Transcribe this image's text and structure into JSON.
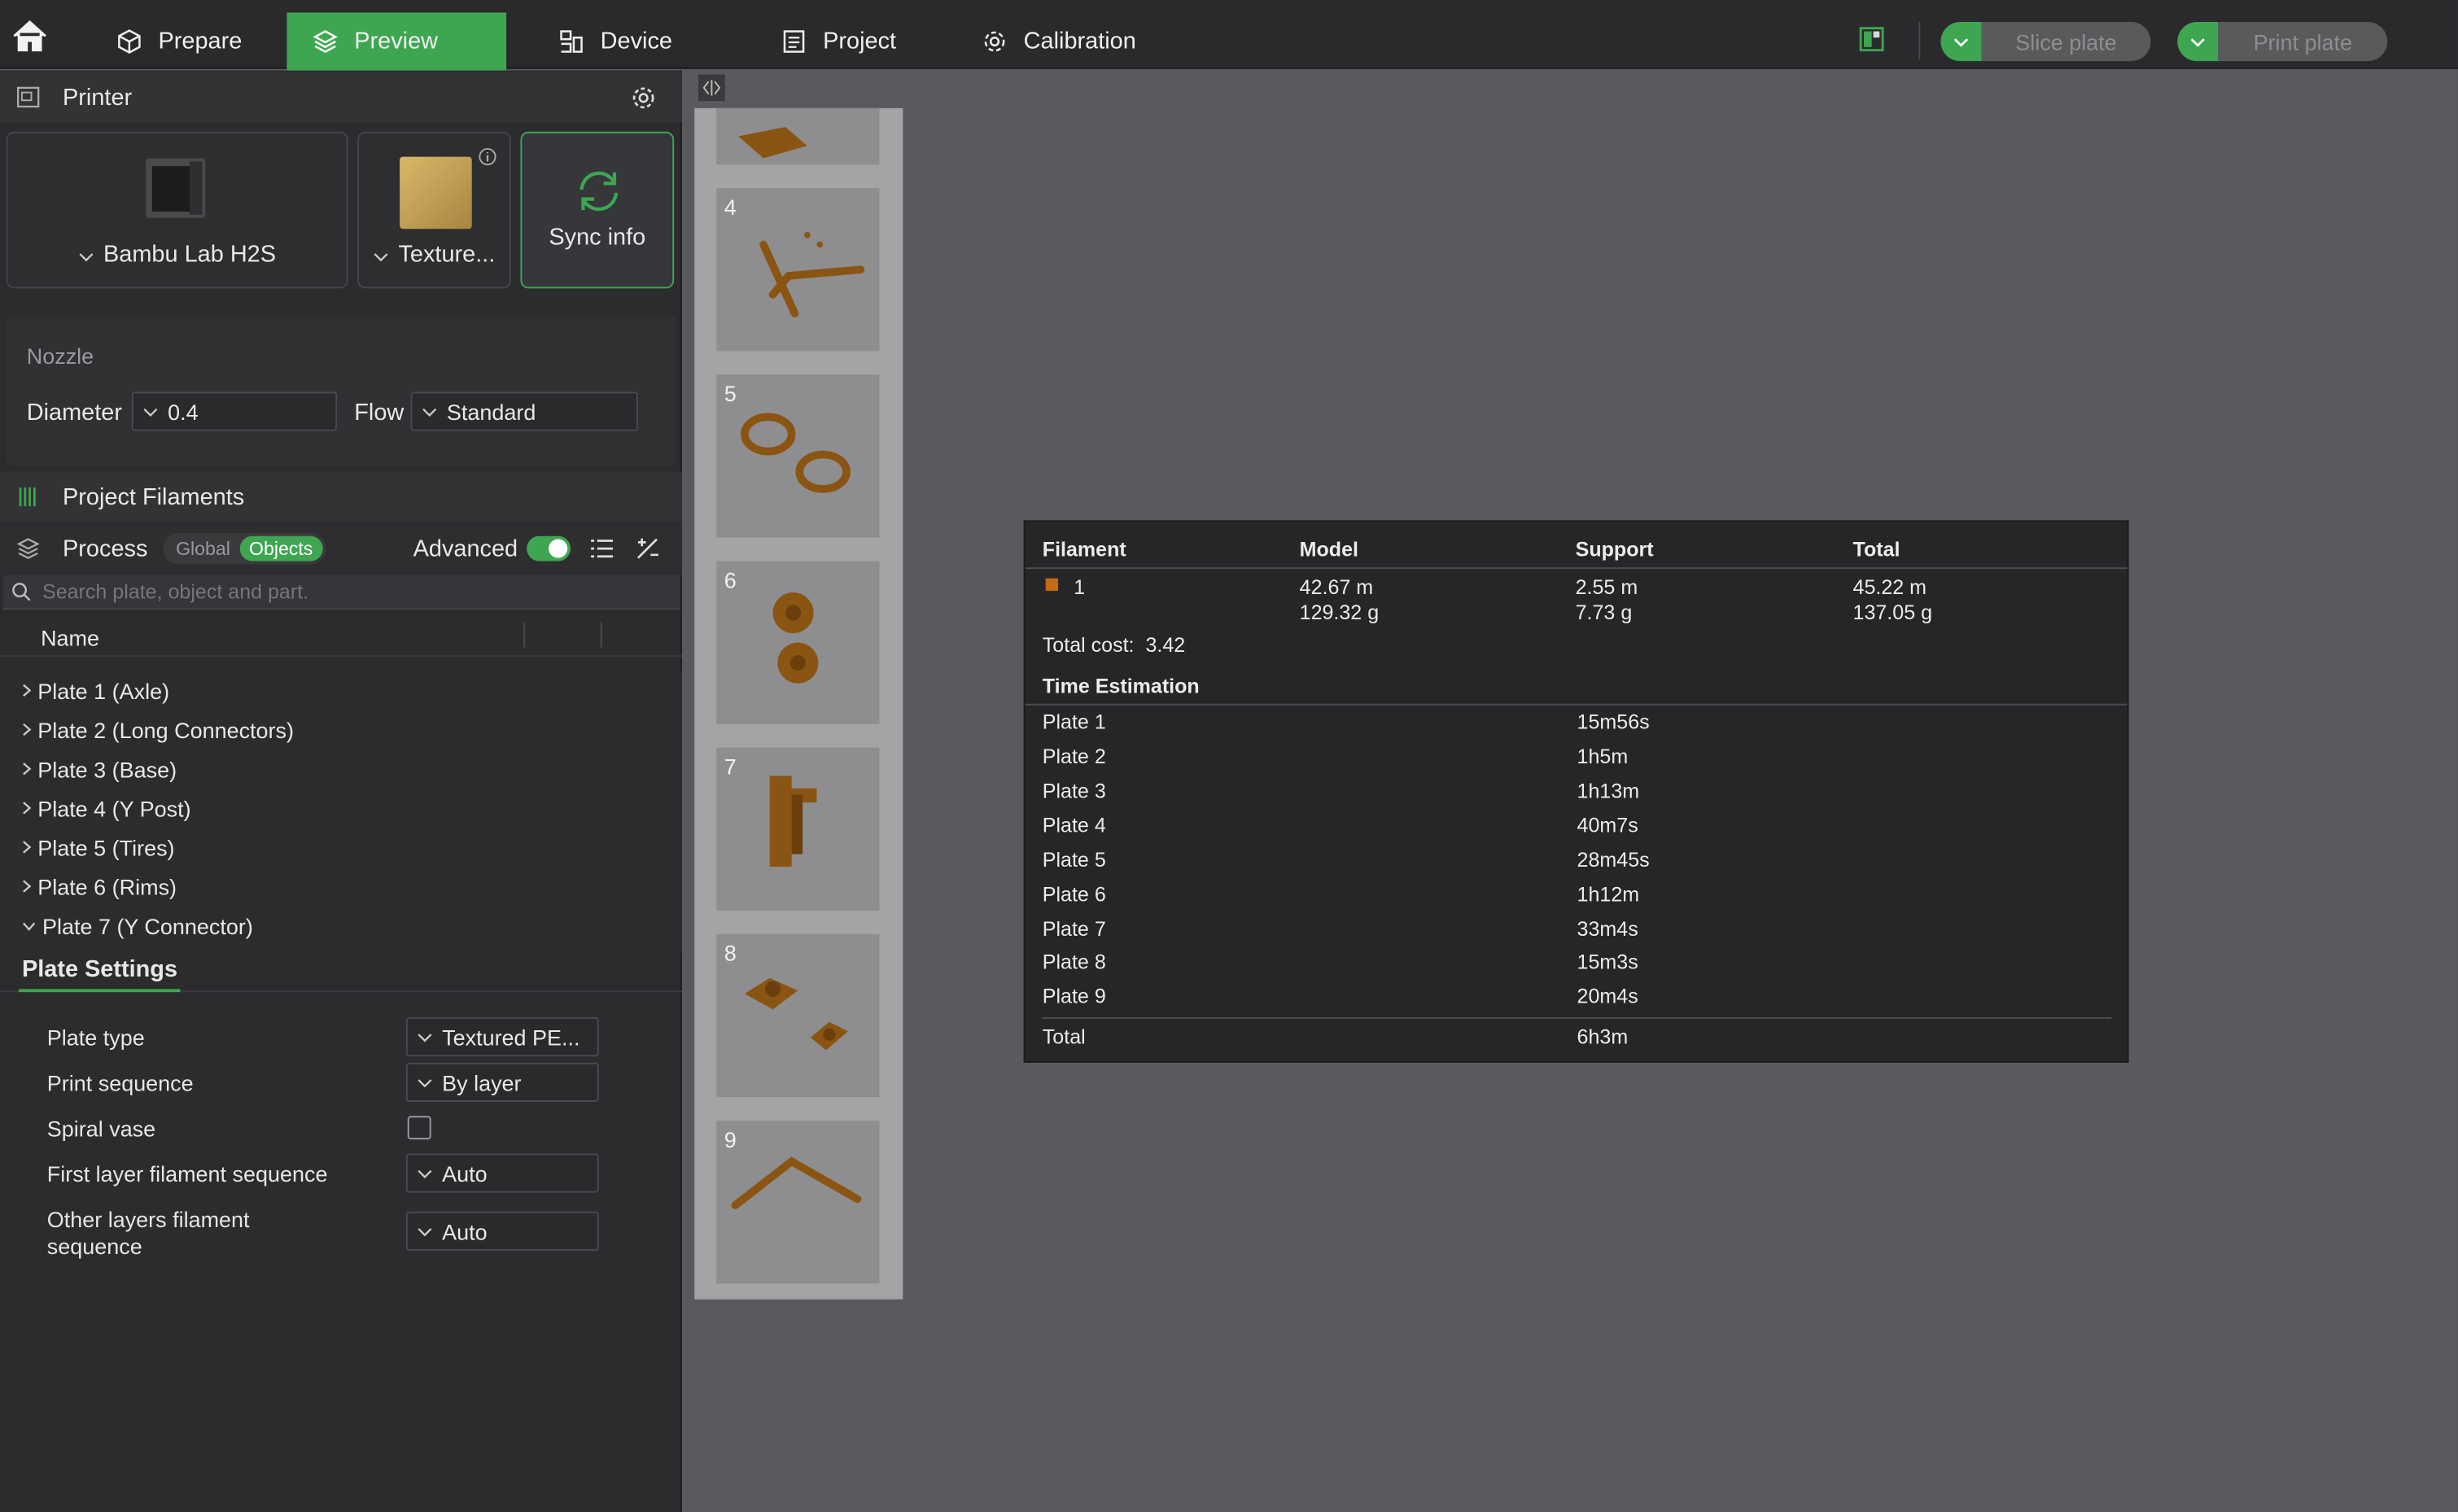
{
  "tabs": [
    {
      "label": "Prepare",
      "icon": "cube-icon"
    },
    {
      "label": "Preview",
      "icon": "layers-icon",
      "active": true
    },
    {
      "label": "Device",
      "icon": "device-icon"
    },
    {
      "label": "Project",
      "icon": "document-icon"
    },
    {
      "label": "Calibration",
      "icon": "gear-icon"
    }
  ],
  "topbar": {
    "slice_label": "Slice plate",
    "print_label": "Print plate"
  },
  "printer": {
    "section_title": "Printer",
    "model": "Bambu Lab H2S",
    "plate": "Texture...",
    "sync_label": "Sync info"
  },
  "nozzle": {
    "title": "Nozzle",
    "diameter_label": "Diameter",
    "diameter_value": "0.4",
    "flow_label": "Flow",
    "flow_value": "Standard"
  },
  "filaments": {
    "title": "Project Filaments"
  },
  "process": {
    "title": "Process",
    "global_label": "Global",
    "objects_label": "Objects",
    "advanced_label": "Advanced",
    "search_placeholder": "Search plate, object and part."
  },
  "tree": {
    "name_header": "Name",
    "items": [
      {
        "label": "Plate 1 (Axle)",
        "expanded": false
      },
      {
        "label": "Plate 2 (Long Connectors)",
        "expanded": false
      },
      {
        "label": "Plate 3 (Base)",
        "expanded": false
      },
      {
        "label": "Plate 4 (Y Post)",
        "expanded": false
      },
      {
        "label": "Plate 5 (Tires)",
        "expanded": false
      },
      {
        "label": "Plate 6 (Rims)",
        "expanded": false
      },
      {
        "label": "Plate 7 (Y Connector)",
        "expanded": true
      }
    ]
  },
  "plate_settings": {
    "tab_label": "Plate Settings",
    "plate_type_label": "Plate type",
    "plate_type_value": "Textured PE...",
    "print_sequence_label": "Print sequence",
    "print_sequence_value": "By layer",
    "spiral_vase_label": "Spiral vase",
    "spiral_vase_checked": false,
    "first_layer_label": "First layer filament sequence",
    "first_layer_value": "Auto",
    "other_layers_label_1": "Other layers filament",
    "other_layers_label_2": "sequence",
    "other_layers_value": "Auto"
  },
  "thumbnails": [
    "4",
    "5",
    "6",
    "7",
    "8",
    "9"
  ],
  "stats": {
    "headers": {
      "filament": "Filament",
      "model": "Model",
      "support": "Support",
      "total": "Total"
    },
    "filament_id": "1",
    "filament_color": "#c46a10",
    "model_length": "42.67 m",
    "model_weight": "129.32 g",
    "support_length": "2.55 m",
    "support_weight": "7.73 g",
    "total_length": "45.22 m",
    "total_weight": "137.05 g",
    "total_cost_label": "Total cost:",
    "total_cost_value": "3.42",
    "time_title": "Time Estimation",
    "times": [
      {
        "plate": "Plate 1",
        "time": "15m56s"
      },
      {
        "plate": "Plate 2",
        "time": "1h5m"
      },
      {
        "plate": "Plate 3",
        "time": "1h13m"
      },
      {
        "plate": "Plate 4",
        "time": "40m7s"
      },
      {
        "plate": "Plate 5",
        "time": "28m45s"
      },
      {
        "plate": "Plate 6",
        "time": "1h12m"
      },
      {
        "plate": "Plate 7",
        "time": "33m4s"
      },
      {
        "plate": "Plate 8",
        "time": "15m3s"
      },
      {
        "plate": "Plate 9",
        "time": "20m4s"
      }
    ],
    "total_label": "Total",
    "total_time": "6h3m"
  },
  "colors": {
    "accent": "#3ea651",
    "model_brown": "#8a5512"
  }
}
